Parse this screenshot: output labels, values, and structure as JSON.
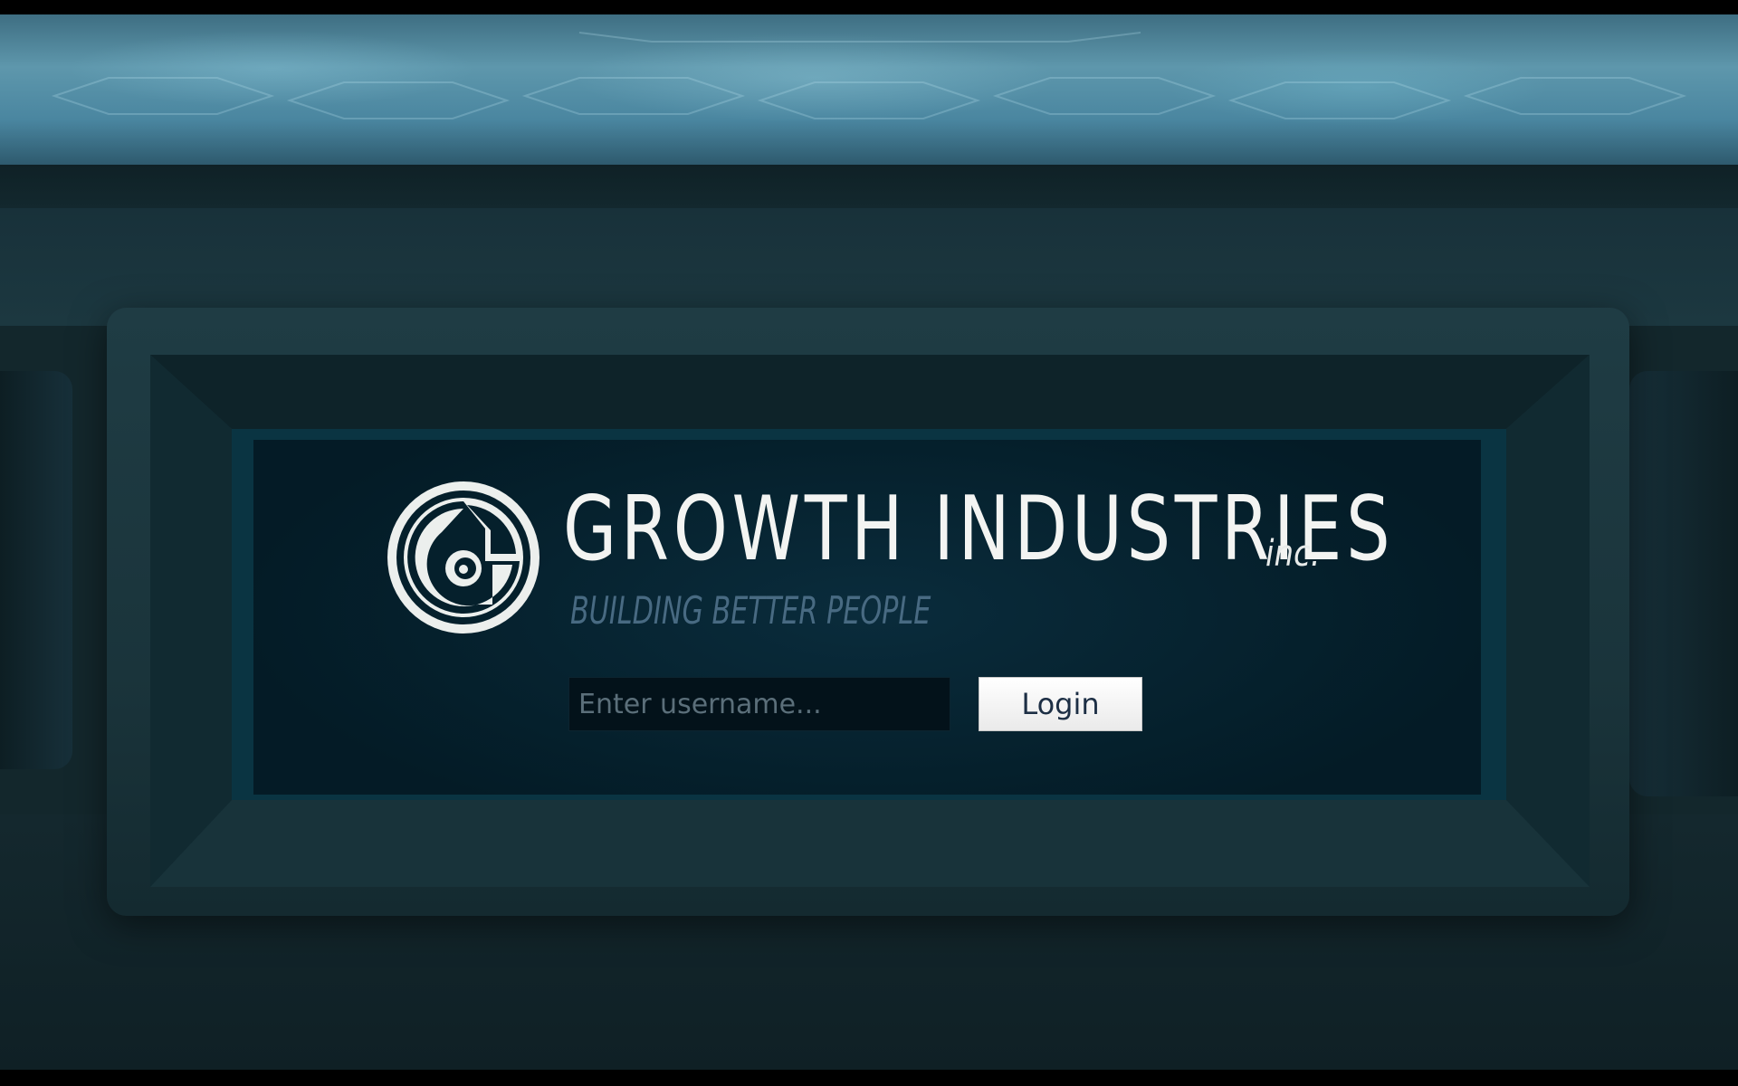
{
  "brand": {
    "name": "GROWTH INDUSTRIES",
    "suffix": "inc.",
    "tagline": "BUILDING BETTER PEOPLE",
    "logo_icon": "growth-g-logo-icon"
  },
  "login": {
    "username_placeholder": "Enter username...",
    "username_value": "",
    "button_label": "Login"
  },
  "colors": {
    "title_text": "#f3f4f2",
    "tagline_text": "#486a82",
    "screen_background": "#05202c",
    "screen_border": "#0a3442",
    "wall": "#1c3840",
    "sky": "#5e97ac"
  }
}
